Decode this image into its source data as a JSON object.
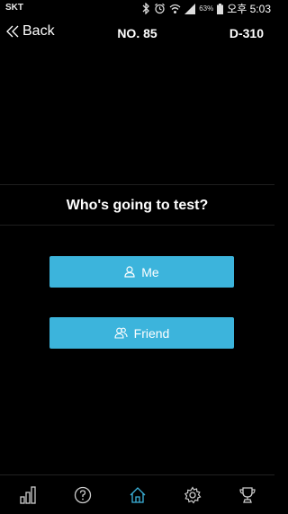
{
  "status_bar": {
    "carrier": "SKT",
    "battery_percent": "63%",
    "time": "오후 5:03"
  },
  "header": {
    "back_label": "Back",
    "record_no": "NO. 85",
    "device": "D-310"
  },
  "main": {
    "question": "Who's going to test?",
    "options": [
      {
        "label": "Me",
        "icon": "person-icon"
      },
      {
        "label": "Friend",
        "icon": "people-icon"
      }
    ]
  },
  "bottom_nav": {
    "items": [
      {
        "icon": "bar-chart-icon",
        "active": false
      },
      {
        "icon": "help-icon",
        "active": false
      },
      {
        "icon": "home-icon",
        "active": true
      },
      {
        "icon": "settings-icon",
        "active": false
      },
      {
        "icon": "trophy-icon",
        "active": false
      }
    ]
  },
  "colors": {
    "accent": "#3cb4dc",
    "background": "#000000",
    "icon": "#cccccc"
  }
}
